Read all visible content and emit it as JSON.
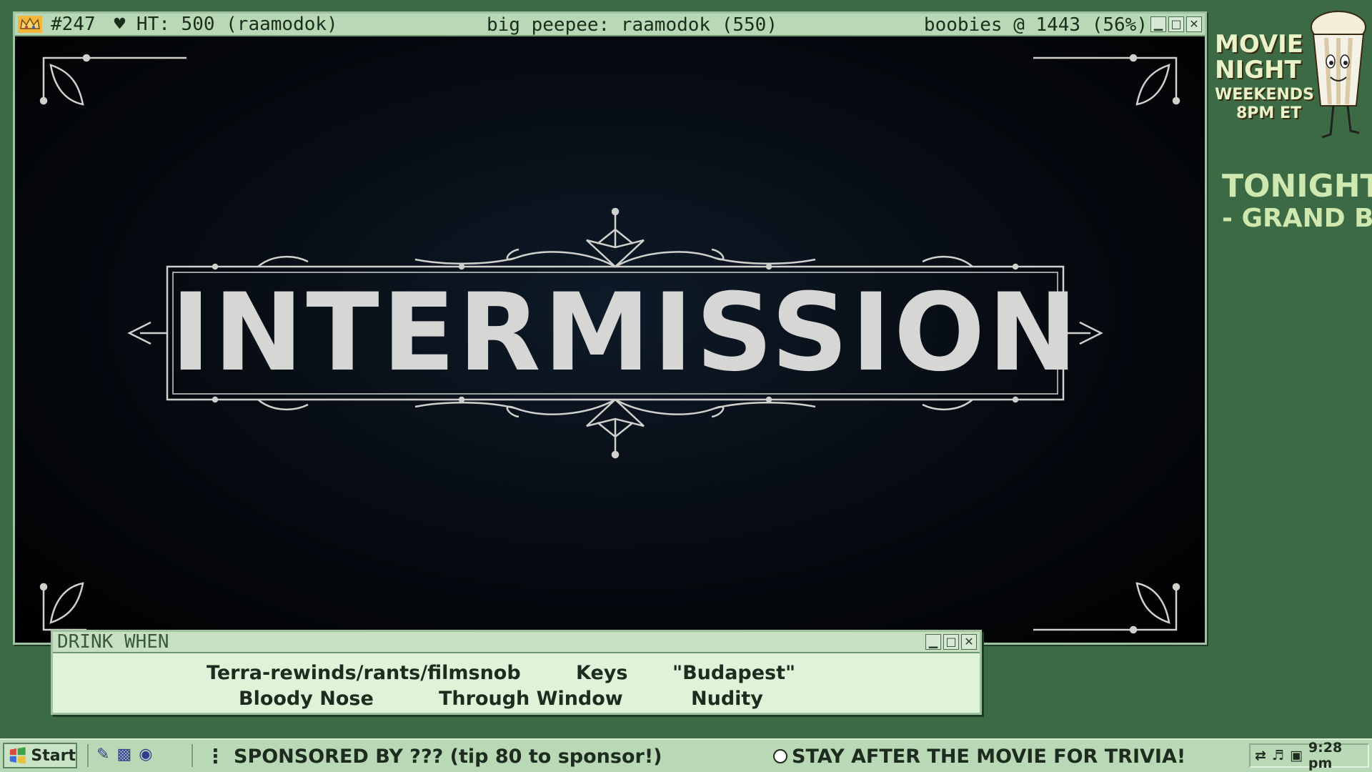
{
  "main_window": {
    "stat_number": "#247",
    "ht_text": "♥ HT: 500 (raamodok)",
    "center_text": "big peepee: raamodok (550)",
    "right_text": "boobies @ 1443 (56%)",
    "buttons": {
      "minimize": "_",
      "maximize": "□",
      "close": "✕"
    },
    "video_title": "INTERMISSION"
  },
  "drink_window": {
    "title": "DRINK WHEN",
    "row1": [
      "Terra-rewinds/rants/filmsnob",
      "Keys",
      "\"Budapest\""
    ],
    "row2": [
      "Bloody Nose",
      "Through Window",
      "Nudity"
    ]
  },
  "overlay": {
    "movie_night_1": "MOVIE",
    "movie_night_2": "NIGHT",
    "weekends": "WEEKENDS",
    "time": "8PM ET",
    "tonight_label": "TONIGHT:",
    "tonight_item": "- GRAND BU"
  },
  "taskbar": {
    "start_label": "Start",
    "sponsor_text": "SPONSORED BY  ??? (tip 80 to sponsor!)",
    "trivia_text": "STAY AFTER THE MOVIE FOR TRIVIA!",
    "clock": "9:28 pm"
  },
  "colors": {
    "desktop": "#3c6a44",
    "window_frame": "#9fc3a0",
    "titlebar": "#b9d8b5",
    "title_text": "#d6d6d4"
  }
}
